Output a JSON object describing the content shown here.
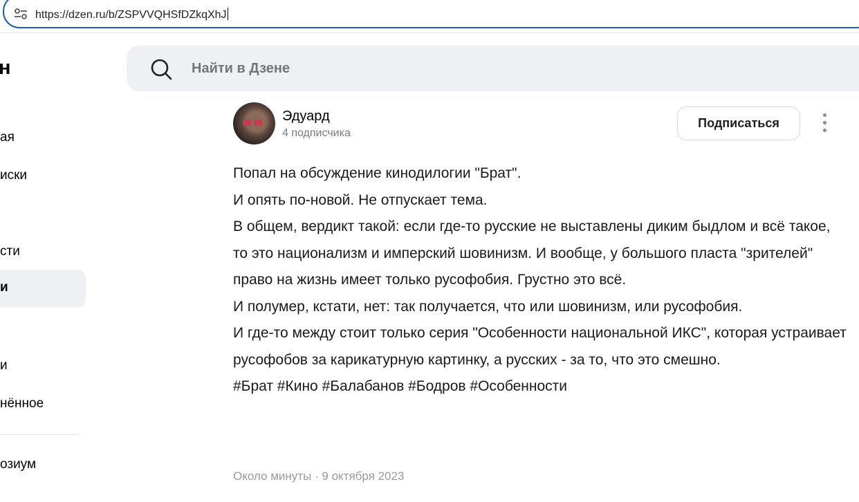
{
  "browser": {
    "url": "https://dzen.ru/b/ZSPVVQHSfDZkqXhJ",
    "site_info_icon": "tune-icon"
  },
  "sidebar": {
    "logo_fragment": "н",
    "items": [
      {
        "label": "ая"
      },
      {
        "label": "иски"
      },
      {
        "label": "сти"
      },
      {
        "label": "и",
        "active": true
      },
      {
        "label": "и"
      },
      {
        "label": "нённое"
      },
      {
        "label": "озиум"
      }
    ]
  },
  "search": {
    "placeholder": "Найти в Дзене",
    "icon": "search-icon"
  },
  "post": {
    "author": "Эдуард",
    "subscribers": "4 подписчика",
    "subscribe_label": "Подписаться",
    "more_icon": "more-vertical-icon",
    "lines": [
      "Попал на обсуждение кинодилогии \"Брат\".",
      "И опять по-новой. Не отпускает тема.",
      "В общем, вердикт такой: если где-то русские не выставлены диким быдлом и всё такое, то это национализм и имперский шовинизм. И вообще, у большого пласта \"зрителей\" право на жизнь имеет только русофобия. Грустно это всё.",
      "И полумер, кстати, нет: так получается, что или шовинизм, или русофобия.",
      "И где-то между стоит только серия \"Особенности национальной ИКС\", которая устраивает русофобов за карикатурную картинку, а русских - за то, что это смешно.",
      "#Брат #Кино #Балабанов #Бодров #Особенности"
    ],
    "meta": "Около минуты · 9 октября 2023"
  },
  "colors": {
    "accent_border": "#1a5fb4",
    "panel_bg": "#eef0f3",
    "muted_text": "#9a9a9a"
  }
}
